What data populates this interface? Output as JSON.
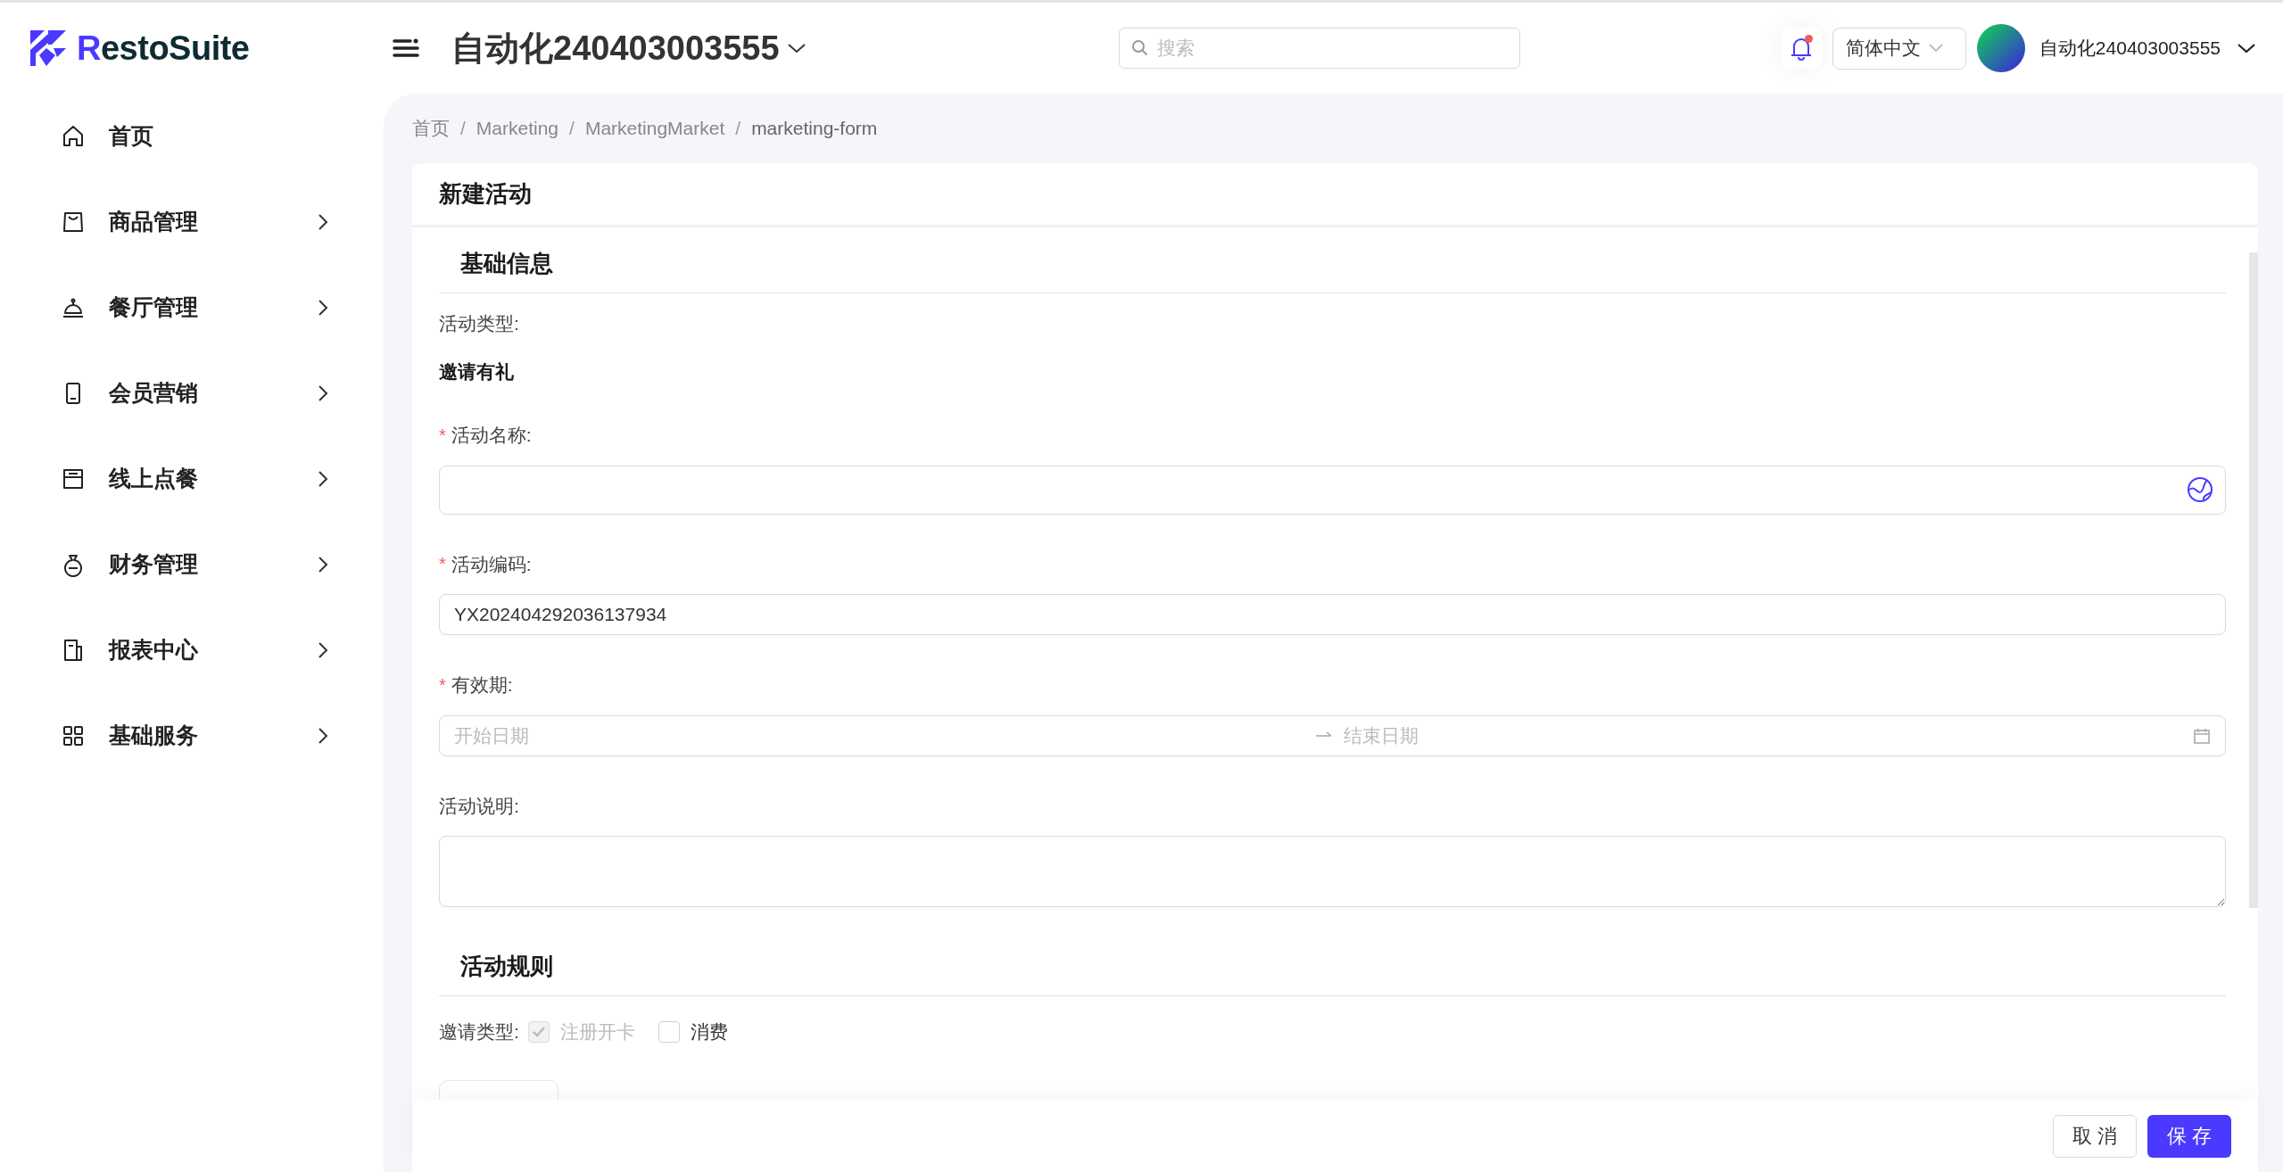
{
  "brand": {
    "accent": "R",
    "rest": "estoSuite"
  },
  "sidebar": {
    "items": [
      {
        "label": "首页",
        "has_submenu": false
      },
      {
        "label": "商品管理",
        "has_submenu": true
      },
      {
        "label": "餐厅管理",
        "has_submenu": true
      },
      {
        "label": "会员营销",
        "has_submenu": true
      },
      {
        "label": "线上点餐",
        "has_submenu": true
      },
      {
        "label": "财务管理",
        "has_submenu": true
      },
      {
        "label": "报表中心",
        "has_submenu": true
      },
      {
        "label": "基础服务",
        "has_submenu": true
      }
    ]
  },
  "header": {
    "title": "自动化240403003555",
    "search": {
      "placeholder": "搜索"
    },
    "notifications": {
      "unread": true
    },
    "language": "简体中文",
    "user": "自动化240403003555"
  },
  "breadcrumb": [
    {
      "label": "首页"
    },
    {
      "separator": "/",
      "label": "Marketing"
    },
    {
      "separator": "/",
      "label": "MarketingMarket"
    },
    {
      "separator": "/",
      "label": "marketing-form"
    }
  ],
  "form": {
    "title": "新建活动",
    "sections": [
      {
        "title": "基础信息",
        "fields": [
          {
            "kind": "static",
            "label": "活动类型:",
            "value": "邀请有礼"
          },
          {
            "kind": "translatable",
            "label": "活动名称:",
            "mark": "*"
          },
          {
            "kind": "text",
            "label": "活动编码:",
            "mark": "*",
            "value": "YX202404292036137934"
          },
          {
            "kind": "daterange",
            "label": "有效期:",
            "mark": "*",
            "start_placeholder": "开始日期",
            "end_placeholder": "结束日期"
          },
          {
            "kind": "textarea",
            "label": "活动说明:"
          }
        ]
      },
      {
        "title": "活动规则",
        "fields": [
          {
            "kind": "checkboxes",
            "label": "邀请类型:",
            "options": [
              {
                "label": "注册开卡",
                "checked": true,
                "disabled": true
              },
              {
                "label": "消费",
                "checked": false,
                "disabled": false
              }
            ]
          },
          {
            "kind": "cut_tab"
          }
        ]
      }
    ]
  },
  "footer": {
    "buttons": [
      {
        "label": "取消",
        "primary": false
      },
      {
        "label": "保存",
        "primary": true
      }
    ]
  }
}
